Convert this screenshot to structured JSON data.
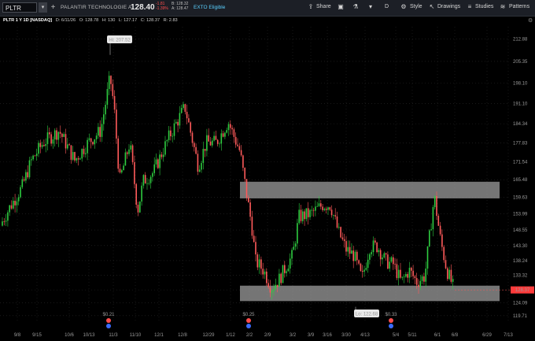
{
  "toolbar": {
    "symbol": "PLTR",
    "dropdown": "▾",
    "company": "PALANTIR TECHNOLOGIE A",
    "last": "128.40",
    "change": "-1.81",
    "change_pct": "-1.39%",
    "bid": "B: 128.32",
    "ask": "A: 128.47",
    "exto": "EXTO Eligible",
    "share": "Share",
    "period": "D",
    "style": "Style",
    "drawings": "Drawings",
    "studies": "Studies",
    "patterns": "Patterns"
  },
  "info": {
    "title": "PLTR 1 Y 1D [NASDAQ]",
    "date": "D: 6/11/26",
    "open": "O: 128.78",
    "high": "H: 130",
    "low": "L: 127.17",
    "close": "C: 128.37",
    "range": "R: 2.83"
  },
  "chart_data": {
    "type": "candlestick",
    "y_ticks": [
      119.71,
      124.09,
      128.37,
      133.32,
      138.24,
      143.3,
      148.55,
      153.99,
      159.63,
      165.48,
      171.54,
      177.83,
      184.34,
      191.1,
      198.1,
      205.35,
      212.88
    ],
    "ylim": [
      117,
      217
    ],
    "x_ticks": [
      "9/8",
      "9/15",
      "10/6",
      "10/13",
      "11/3",
      "11/10",
      "12/1",
      "12/8",
      "12/29",
      "1/12",
      "2/2",
      "2/9",
      "3/2",
      "3/9",
      "3/16",
      "3/30",
      "4/13",
      "5/4",
      "5/11",
      "6/1",
      "6/8",
      "6/29",
      "7/13"
    ],
    "current_price": "128.37",
    "high_label": "Hi: 207.52",
    "low_label": "Lo: 122.68",
    "high_value": 207.52,
    "low_value": 122.68,
    "zones": [
      {
        "top": 164.8,
        "bottom": 159.2
      },
      {
        "top": 129.8,
        "bottom": 124.6
      }
    ],
    "dividends": [
      {
        "label": "$0.21",
        "x_index": 2
      },
      {
        "label": "$0.25",
        "x_index": 10
      },
      {
        "label": "$0.33",
        "x_index": 17
      }
    ],
    "grid": true,
    "up_color": "#2ecc40",
    "down_color": "#ff5a5a"
  }
}
